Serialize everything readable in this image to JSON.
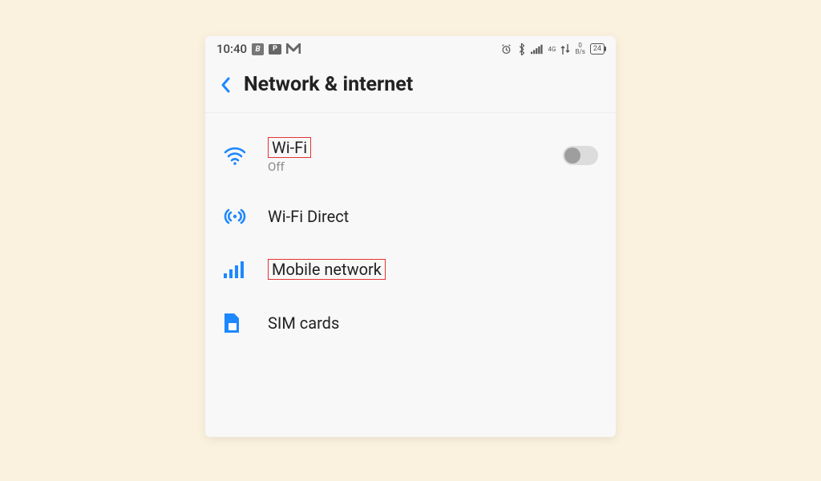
{
  "statusbar": {
    "time": "10:40",
    "notif_b": "B",
    "notif_p": "P",
    "data_label": "4G",
    "net_speed_value": "0",
    "net_speed_unit": "B/s",
    "battery_text": "24"
  },
  "header": {
    "title": "Network & internet"
  },
  "items": {
    "wifi": {
      "label": "Wi-Fi",
      "sub": "Off"
    },
    "wifidirect": {
      "label": "Wi-Fi Direct"
    },
    "mobile": {
      "label": "Mobile network"
    },
    "sim": {
      "label": "SIM cards"
    }
  }
}
